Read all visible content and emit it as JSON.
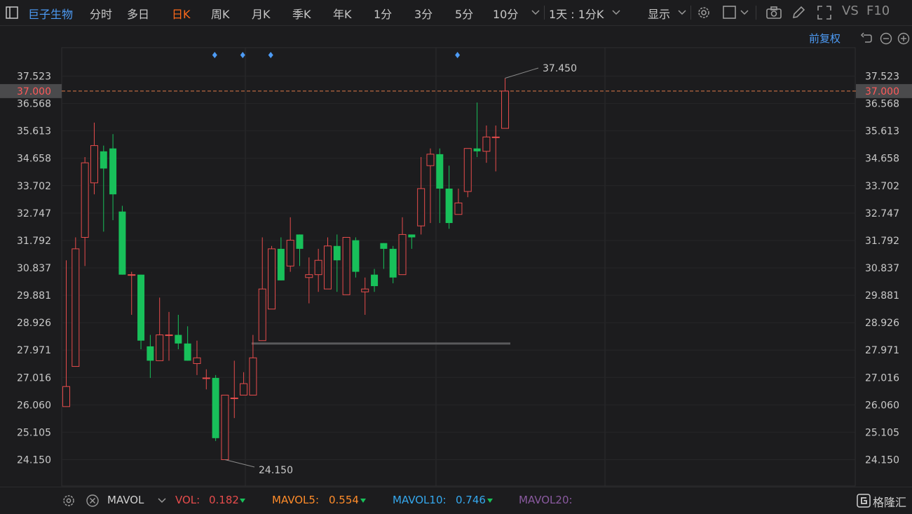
{
  "toolbar": {
    "stock_name": "巨子生物",
    "tabs": [
      {
        "label": "分时"
      },
      {
        "label": "多日"
      },
      {
        "label": "日K",
        "active": true
      },
      {
        "label": "周K"
      },
      {
        "label": "月K"
      },
      {
        "label": "季K"
      },
      {
        "label": "年K"
      },
      {
        "label": "1分"
      },
      {
        "label": "3分"
      },
      {
        "label": "5分"
      },
      {
        "label": "10分"
      }
    ],
    "period_select": "1天 : 1分K",
    "display_label": "显示",
    "vs_label": "VS",
    "f10_label": "F10"
  },
  "subbar": {
    "adjust_label": "前复权"
  },
  "price_axis": {
    "ticks": [
      "37.523",
      "36.568",
      "35.613",
      "34.658",
      "33.702",
      "32.747",
      "31.792",
      "30.837",
      "29.881",
      "28.926",
      "27.971",
      "27.016",
      "26.060",
      "25.105",
      "24.150"
    ],
    "current_price": "37.000",
    "current_price_value": 37.0
  },
  "annotations": {
    "high_label": "37.450",
    "low_label": "24.150"
  },
  "chart_data": {
    "type": "candlestick",
    "ylim": [
      23.7,
      38.0
    ],
    "candles": [
      {
        "o": 26.0,
        "c": 26.7,
        "h": 31.1,
        "l": 26.0
      },
      {
        "o": 27.4,
        "c": 31.5,
        "h": 31.9,
        "l": 27.4
      },
      {
        "o": 31.9,
        "c": 34.5,
        "h": 34.7,
        "l": 30.9
      },
      {
        "o": 33.8,
        "c": 35.1,
        "h": 35.9,
        "l": 33.4
      },
      {
        "o": 34.9,
        "c": 34.3,
        "h": 35.1,
        "l": 32.1
      },
      {
        "o": 35.0,
        "c": 33.4,
        "h": 35.5,
        "l": 32.5
      },
      {
        "o": 32.8,
        "c": 30.6,
        "h": 33.0,
        "l": 30.6
      },
      {
        "o": 30.6,
        "c": 30.6,
        "h": 30.7,
        "l": 29.2
      },
      {
        "o": 30.6,
        "c": 28.3,
        "h": 30.6,
        "l": 28.0
      },
      {
        "o": 28.1,
        "c": 27.6,
        "h": 28.5,
        "l": 27.0
      },
      {
        "o": 27.6,
        "c": 28.5,
        "h": 29.8,
        "l": 27.6
      },
      {
        "o": 28.5,
        "c": 28.5,
        "h": 29.3,
        "l": 27.6
      },
      {
        "o": 28.5,
        "c": 28.2,
        "h": 29.2,
        "l": 28.0
      },
      {
        "o": 28.2,
        "c": 27.6,
        "h": 28.8,
        "l": 27.6
      },
      {
        "o": 27.5,
        "c": 27.7,
        "h": 28.3,
        "l": 27.1
      },
      {
        "o": 27.0,
        "c": 27.0,
        "h": 27.3,
        "l": 26.6
      },
      {
        "o": 27.0,
        "c": 24.9,
        "h": 27.1,
        "l": 24.8
      },
      {
        "o": 24.15,
        "c": 26.4,
        "h": 26.4,
        "l": 24.15
      },
      {
        "o": 26.3,
        "c": 26.3,
        "h": 27.6,
        "l": 25.6
      },
      {
        "o": 26.4,
        "c": 26.8,
        "h": 27.2,
        "l": 26.5
      },
      {
        "o": 26.4,
        "c": 27.7,
        "h": 28.5,
        "l": 26.4
      },
      {
        "o": 28.3,
        "c": 30.1,
        "h": 31.9,
        "l": 28.3
      },
      {
        "o": 29.4,
        "c": 31.5,
        "h": 31.6,
        "l": 29.4
      },
      {
        "o": 31.5,
        "c": 30.4,
        "h": 31.9,
        "l": 30.4
      },
      {
        "o": 30.9,
        "c": 31.8,
        "h": 32.6,
        "l": 30.7
      },
      {
        "o": 32.0,
        "c": 31.5,
        "h": 32.0,
        "l": 30.9
      },
      {
        "o": 30.5,
        "c": 30.6,
        "h": 31.2,
        "l": 29.6
      },
      {
        "o": 30.6,
        "c": 31.1,
        "h": 31.5,
        "l": 30.0
      },
      {
        "o": 30.1,
        "c": 31.6,
        "h": 31.9,
        "l": 30.1
      },
      {
        "o": 31.6,
        "c": 31.1,
        "h": 32.0,
        "l": 30.0
      },
      {
        "o": 29.9,
        "c": 31.9,
        "h": 31.9,
        "l": 29.9
      },
      {
        "o": 31.8,
        "c": 30.7,
        "h": 31.9,
        "l": 30.5
      },
      {
        "o": 30.0,
        "c": 30.1,
        "h": 30.5,
        "l": 29.2
      },
      {
        "o": 30.6,
        "c": 30.2,
        "h": 30.8,
        "l": 30.0
      },
      {
        "o": 31.7,
        "c": 31.5,
        "h": 31.7,
        "l": 30.8
      },
      {
        "o": 31.5,
        "c": 30.5,
        "h": 31.6,
        "l": 30.3
      },
      {
        "o": 30.6,
        "c": 32.0,
        "h": 32.6,
        "l": 30.6
      },
      {
        "o": 32.0,
        "c": 31.9,
        "h": 32.0,
        "l": 31.5
      },
      {
        "o": 32.3,
        "c": 33.6,
        "h": 34.7,
        "l": 32.0
      },
      {
        "o": 34.4,
        "c": 34.8,
        "h": 35.0,
        "l": 32.4
      },
      {
        "o": 34.8,
        "c": 33.6,
        "h": 35.0,
        "l": 32.4
      },
      {
        "o": 33.6,
        "c": 32.4,
        "h": 34.4,
        "l": 32.2
      },
      {
        "o": 32.7,
        "c": 33.1,
        "h": 33.6,
        "l": 32.7
      },
      {
        "o": 33.5,
        "c": 35.0,
        "h": 35.0,
        "l": 33.3
      },
      {
        "o": 35.0,
        "c": 34.9,
        "h": 36.6,
        "l": 34.7
      },
      {
        "o": 34.9,
        "c": 35.4,
        "h": 35.8,
        "l": 34.5
      },
      {
        "o": 35.4,
        "c": 35.4,
        "h": 35.8,
        "l": 34.2
      },
      {
        "o": 35.7,
        "c": 37.0,
        "h": 37.45,
        "l": 35.7
      }
    ],
    "event_marker_indices": [
      15,
      18,
      21,
      41
    ],
    "support_line_price": 28.2
  },
  "bottom": {
    "indicator": "MAVOL",
    "vol_label": "VOL:",
    "vol_value": "0.182",
    "mavol5_label": "MAVOL5:",
    "mavol5_value": "0.554",
    "mavol10_label": "MAVOL10:",
    "mavol10_value": "0.746",
    "mavol20_label": "MAVOL20:",
    "brand": "格隆汇"
  },
  "colors": {
    "up": "#e74c4c",
    "down": "#18c05a",
    "accent": "#ff6a1a",
    "stock_blue": "#4d9bf5",
    "mavol5": "#ff8c2a",
    "mavol10": "#35a8ee",
    "mavol20": "#8a5aa0"
  }
}
